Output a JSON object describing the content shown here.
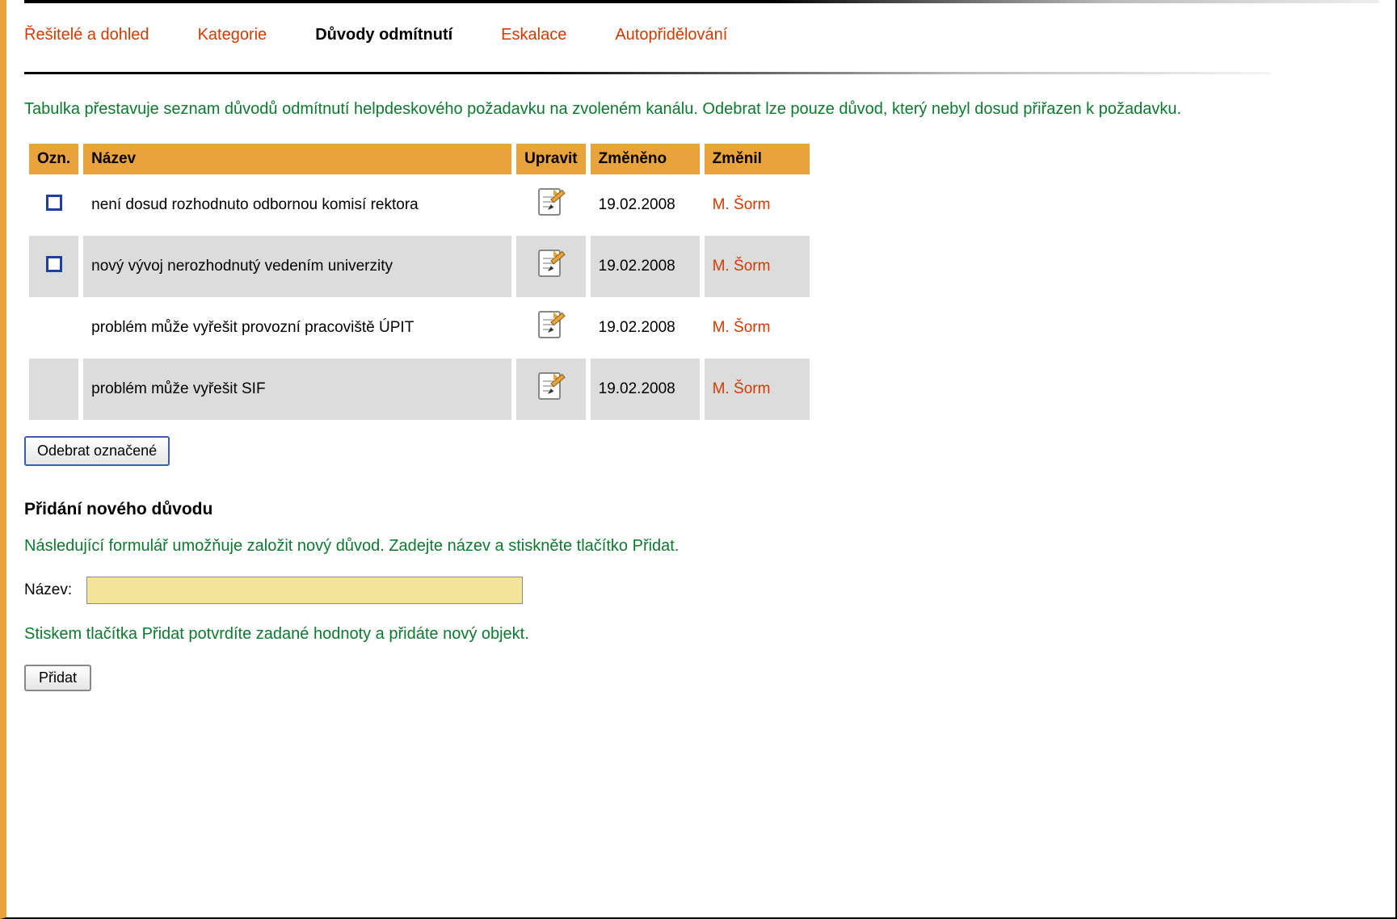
{
  "tabs": [
    {
      "label": "Řešitelé a dohled",
      "active": false
    },
    {
      "label": "Kategorie",
      "active": false
    },
    {
      "label": "Důvody odmítnutí",
      "active": true
    },
    {
      "label": "Eskalace",
      "active": false
    },
    {
      "label": "Autopřidělování",
      "active": false
    }
  ],
  "intro_text": "Tabulka přestavuje seznam důvodů odmítnutí helpdeskového požadavku na zvoleném kanálu. Odebrat lze pouze důvod, který nebyl dosud přiřazen k požadavku.",
  "table": {
    "headers": {
      "ozn": "Ozn.",
      "nazev": "Název",
      "upravit": "Upravit",
      "zmeneno": "Změněno",
      "zmenil": "Změnil"
    },
    "rows": [
      {
        "checkbox": true,
        "nazev": "není dosud rozhodnuto odbornou komisí rektora",
        "zmeneno": "19.02.2008",
        "zmenil": "M. Šorm"
      },
      {
        "checkbox": true,
        "nazev": "nový vývoj nerozhodnutý vedením univerzity",
        "zmeneno": "19.02.2008",
        "zmenil": "M. Šorm"
      },
      {
        "checkbox": false,
        "nazev": "problém může vyřešit provozní pracoviště ÚPIT",
        "zmeneno": "19.02.2008",
        "zmenil": "M. Šorm"
      },
      {
        "checkbox": false,
        "nazev": "problém může vyřešit SIF",
        "zmeneno": "19.02.2008",
        "zmenil": "M. Šorm"
      }
    ]
  },
  "buttons": {
    "remove_selected": "Odebrat označené",
    "add": "Přidat"
  },
  "add_section": {
    "heading": "Přidání nového důvodu",
    "desc1": "Následující formulář umožňuje založit nový důvod. Zadejte název a stiskněte tlačítko Přidat.",
    "field_label": "Název:",
    "field_value": "",
    "desc2": "Stiskem tlačítka Přidat potvrdíte zadané hodnoty a přidáte nový objekt."
  }
}
